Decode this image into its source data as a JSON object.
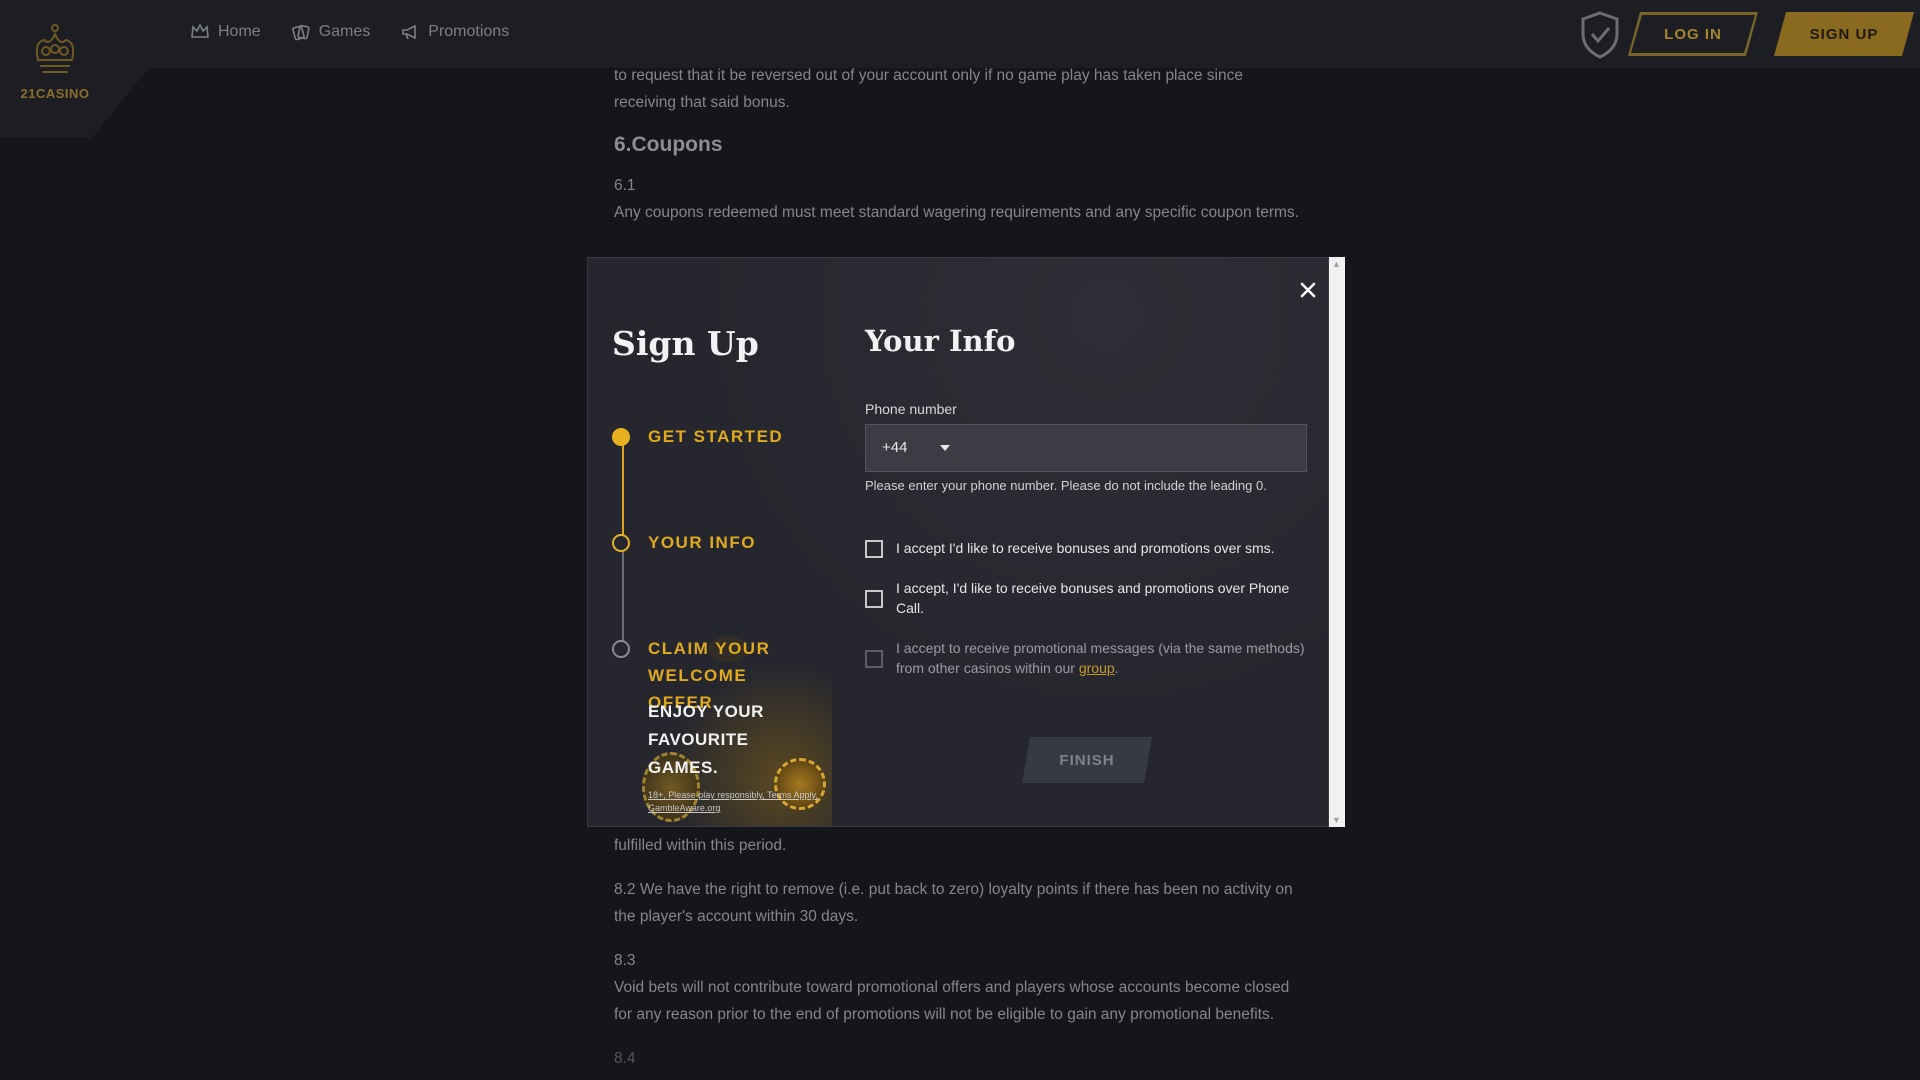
{
  "header": {
    "logo_text": "21CASINO",
    "nav": [
      {
        "label": "Home",
        "icon": "crown-icon"
      },
      {
        "label": "Games",
        "icon": "cards-icon"
      },
      {
        "label": "Promotions",
        "icon": "megaphone-icon"
      }
    ],
    "login_label": "LOG IN",
    "signup_label": "SIGN UP"
  },
  "article": {
    "para_top": "to request that it be reversed out of your account only if no game play has taken place since receiving that said bonus.",
    "heading_6": "6.Coupons",
    "num_6_1": "6.1",
    "text_6_1": "Any coupons redeemed must meet standard wagering requirements and any specific coupon terms.",
    "fragment": "fulfilled within this period.",
    "text_8_2": "8.2 We have the right to remove (i.e. put back to zero) loyalty points if there has been no activity on the player's account within 30 days.",
    "num_8_3": "8.3",
    "text_8_3": "Void bets will not contribute toward promotional offers and players whose accounts become closed for any reason prior to the end of promotions will not be eligible to gain any promotional benefits.",
    "num_8_4": "8.4"
  },
  "modal": {
    "title": "Sign Up",
    "section_title": "Your Info",
    "steps": [
      {
        "label": "GET STARTED",
        "state": "done"
      },
      {
        "label": "YOUR INFO",
        "state": "current"
      },
      {
        "label": "CLAIM YOUR WELCOME OFFER.",
        "state": "pending"
      }
    ],
    "promo_text": "ENJOY YOUR FAVOURITE GAMES.",
    "promo_fineprint": "18+, Please play responsibly, Terms Apply, GambleAware.org",
    "phone_label": "Phone number",
    "country_code": "+44",
    "phone_value": "",
    "phone_hint": "Please enter your phone number. Please do not include the leading 0.",
    "consents": [
      {
        "text": "I accept I'd like to receive bonuses and promotions over sms.",
        "checked": false
      },
      {
        "text": "I accept, I'd like to receive bonuses and promotions over Phone Call.",
        "checked": false
      },
      {
        "text_before": "I accept to receive promotional messages (via the same methods) from other casinos within our ",
        "link": "group",
        "text_after": ".",
        "checked": false
      }
    ],
    "finish_label": "FINISH"
  },
  "colors": {
    "accent": "#e6b020",
    "background": "#15161b",
    "modal": "#26272e"
  }
}
